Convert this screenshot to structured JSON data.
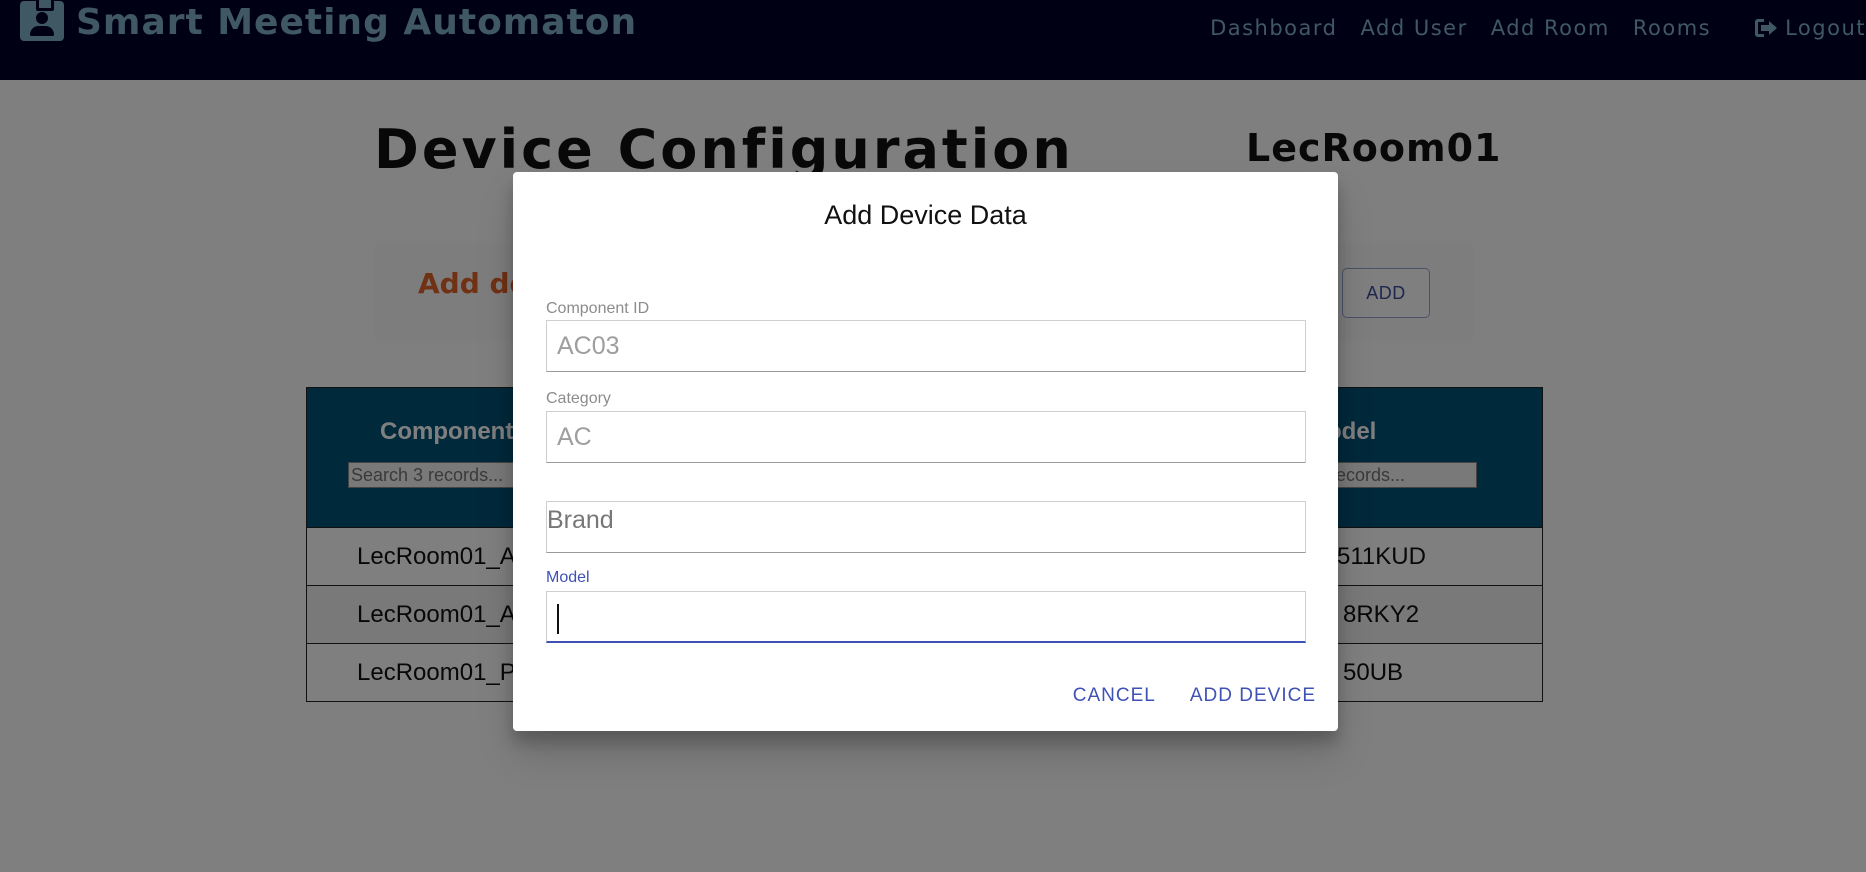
{
  "navbar": {
    "brand": "Smart Meeting Automaton",
    "brand_icon": "id-badge-icon",
    "links": [
      "Dashboard",
      "Add User",
      "Add Room",
      "Rooms"
    ],
    "logout_label": "Logout",
    "logout_icon": "sign-out-icon"
  },
  "page": {
    "title": "Device Configuration",
    "room": "LecRoom01",
    "add_panel_label": "Add de",
    "add_button": "ADD"
  },
  "table": {
    "col1_header": "Component",
    "col1_search_placeholder": "Search 3 records...",
    "col2_header": "odel",
    "col2_search_placeholder": "records...",
    "rows": [
      {
        "c1": "LecRoom01_A",
        "c2": "511KUD"
      },
      {
        "c1": "LecRoom01_A",
        "c2": "8RKY2"
      },
      {
        "c1": "LecRoom01_P",
        "c2": "50UB"
      }
    ]
  },
  "dialog": {
    "title": "Add Device Data",
    "component_id_label": "Component ID",
    "component_id_value": "AC03",
    "category_label": "Category",
    "category_value": "AC",
    "brand_placeholder": "Brand",
    "model_label": "Model",
    "model_value": "",
    "cancel": "CANCEL",
    "add_device": "ADD DEVICE"
  },
  "colors": {
    "navbar_bg": "#00002a",
    "brand": "#7fb0c6",
    "table_header": "#005377",
    "accent": "#3f51b5",
    "add_label": "#e0622a"
  }
}
